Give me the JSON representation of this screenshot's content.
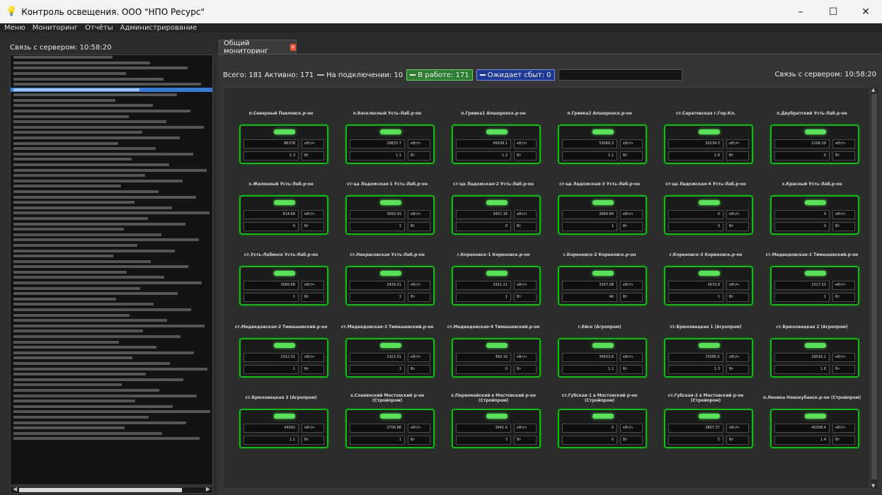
{
  "window": {
    "title": "Контроль освещения. ООО \"НПО Ресурс\"",
    "minimize": "–",
    "maximize": "☐",
    "close": "✕"
  },
  "menu": [
    "Меню",
    "Мониторинг",
    "Отчёты",
    "Администрирование"
  ],
  "left": {
    "connection": "Связь с сервером: 10:58:20",
    "log_row_count": 72,
    "selected_row": 6
  },
  "tab": {
    "label": "Общий мониторинг",
    "close": "×"
  },
  "status": {
    "total": "Всего: 181",
    "active": "Активно: 171",
    "connecting": "На подключении: 10",
    "working": "В работе: 171",
    "waiting": "Ожидает сбыт: 0",
    "server": "Связь с сервером: 10:58:20"
  },
  "units": {
    "power": "кВт/ч",
    "current": "Вт"
  },
  "colors": {
    "accent_green": "#1db51d",
    "led": "#5ce05c",
    "selected": "#3a7bd5"
  },
  "objects": [
    {
      "name": "п.Северный Павловск.р-он",
      "v1": "86378",
      "v2": "1.3"
    },
    {
      "name": "п.Бесклесный Усть-Лаб.р-он",
      "v1": "29833.7",
      "v2": "1.1"
    },
    {
      "name": "п.Гривка1 Апшеронск.р-он",
      "v1": "45639.1",
      "v2": "1.3"
    },
    {
      "name": "п.Гривка2 Апшеронск.р-он",
      "v1": "53060.3",
      "v2": "1.1"
    },
    {
      "name": "ст.Саратовская г.Гор.Кл.",
      "v1": "30234.3",
      "v2": "1.8"
    },
    {
      "name": "п.Двубратский Усть-Лаб.р-он",
      "v1": "2108.29",
      "v2": "0"
    },
    {
      "name": "х.Железный Усть-Лаб.р-он",
      "v1": "614.68",
      "v2": "0"
    },
    {
      "name": "ст-ца Ладожская-1 Усть-Лаб.р-он",
      "v1": "3993.93",
      "v2": "1"
    },
    {
      "name": "ст-ца Ладожская-2 Усть-Лаб.р-он",
      "v1": "3407.18",
      "v2": "0"
    },
    {
      "name": "ст-ца Ладожская-3 Усть-Лаб.р-он",
      "v1": "3660.84",
      "v2": "1"
    },
    {
      "name": "ст-ца Ладожская-4 Усть-Лаб.р-он",
      "v1": "0",
      "v2": "0"
    },
    {
      "name": "х.Красный Усть-Лаб.р-он",
      "v1": "0",
      "v2": "0"
    },
    {
      "name": "ст.Усть-Лабинск Усть-Лаб.р-он",
      "v1": "3060.68",
      "v2": "1"
    },
    {
      "name": "ст.Некрасовская Усть-Лаб.р-он",
      "v1": "2429.21",
      "v2": "2"
    },
    {
      "name": "г.Кореновск-1 Кореновск.р-он",
      "v1": "3321.21",
      "v2": "1"
    },
    {
      "name": "г.Кореновск-2 Кореновск.р-он",
      "v1": "3307.08",
      "v2": "46"
    },
    {
      "name": "г.Кореновск-3 Кореновск.р-он",
      "v1": "3433.8",
      "v2": "1"
    },
    {
      "name": "ст.Медведовская-1 Тимашевский.р-он",
      "v1": "2317.53",
      "v2": "1"
    },
    {
      "name": "ст.Медведовская-2 Тимашевский.р-он",
      "v1": "2312.31",
      "v2": "1"
    },
    {
      "name": "ст.Медведовская-3 Тимашевский.р-он",
      "v1": "2322.01",
      "v2": "3"
    },
    {
      "name": "ст.Медведовская-4 Тимашевский.р-он",
      "v1": "360.16",
      "v2": "0"
    },
    {
      "name": "г.Ейск (Агропром)",
      "v1": "34503.8",
      "v2": "1.1"
    },
    {
      "name": "ст.Брюховецкая 1 (Агропром)",
      "v1": "35585.5",
      "v2": "1.3"
    },
    {
      "name": "ст.Брюховецкая 2 (Агропром)",
      "v1": "29516.1",
      "v2": "1.6"
    },
    {
      "name": "ст.Брюховецкая 3 (Агропром)",
      "v1": "44092",
      "v2": "1.1"
    },
    {
      "name": "х.Славянский Мостовский р-он (Стройпром)",
      "v1": "3706.88",
      "v2": "1"
    },
    {
      "name": "х.Первомайский в Мостовский р-он (Стройпром)",
      "v1": "3941.6",
      "v2": "3"
    },
    {
      "name": "ст.Губская-1 в Мостовский р-он (Стройпром)",
      "v1": "0",
      "v2": "0"
    },
    {
      "name": "ст.Губская-2 в Мостовский р-он (Стройпром)",
      "v1": "3807.37",
      "v2": "5"
    },
    {
      "name": "п.Ленина Новокубанск.р-он (Стройпром)",
      "v1": "40308.4",
      "v2": "1.4"
    }
  ]
}
